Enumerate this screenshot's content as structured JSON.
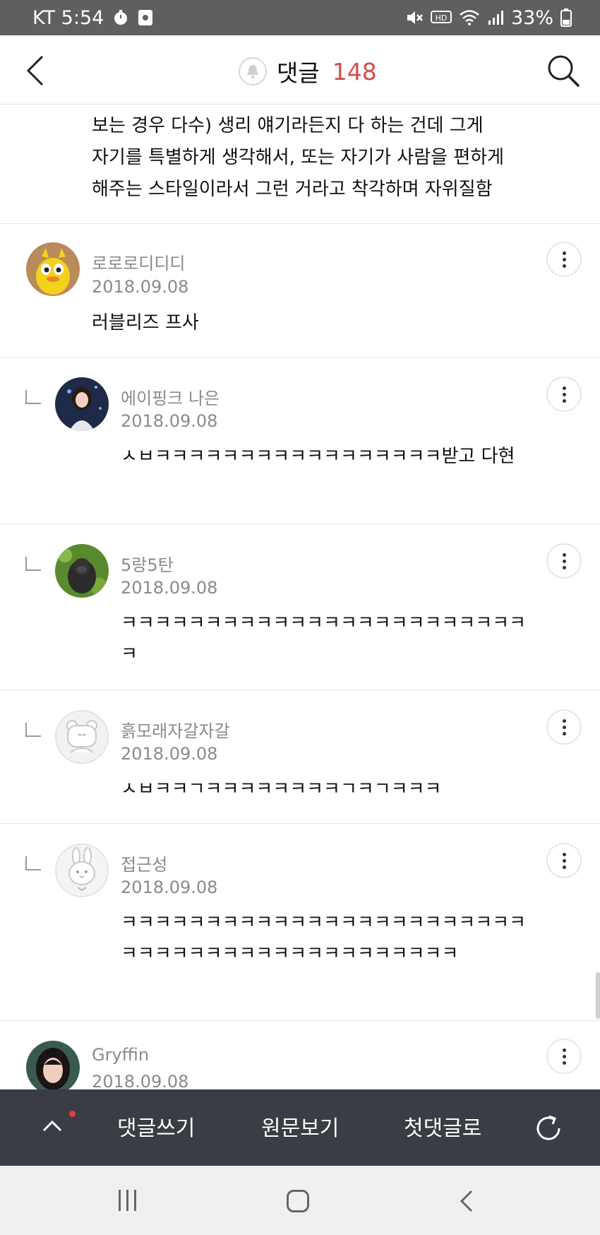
{
  "status_bar": {
    "carrier_time": "KT 5:54",
    "battery": "33%",
    "icons": [
      "timer-icon",
      "screen-record-icon",
      "mute-icon",
      "hd-icon",
      "wifi-icon",
      "signal-icon",
      "battery-icon"
    ]
  },
  "header": {
    "title": "댓글",
    "count": "148",
    "icons": [
      "back-arrow-icon",
      "bell-icon",
      "search-icon"
    ]
  },
  "previous_comment_tail": {
    "lines": [
      "보는 경우 다수) 생리 얘기라든지 다 하는 건데 그게",
      "자기를 특별하게 생각해서, 또는 자기가 사람을 편하게",
      "해주는 스타일이라서 그런 거라고 착각하며 자위질함"
    ]
  },
  "comments": [
    {
      "name": "로로로디디디",
      "date": "2018.09.08",
      "body": "러블리즈 프사",
      "reply": false,
      "avatar": "yellow-character"
    },
    {
      "name": "에이핑크 나은",
      "date": "2018.09.08",
      "body": "ㅅㅂㅋㅋㅋㅋㅋㅋㅋㅋㅋㅋㅋㅋㅋㅋㅋㅋㅋ받고 다현",
      "reply": true,
      "avatar": "person-photo"
    },
    {
      "name": "5랑5탄",
      "date": "2018.09.08",
      "body": "ㅋㅋㅋㅋㅋㅋㅋㅋㅋㅋㅋㅋㅋㅋㅋㅋㅋㅋㅋㅋㅋㅋㅋㅋㅋ",
      "reply": true,
      "avatar": "gorilla-photo"
    },
    {
      "name": "흙모래자갈자갈",
      "date": "2018.09.08",
      "body": "ㅅㅂㅋㅋㄱㅋㅋㅋㅋㅋㅋㅋㅋㄱㅋㄱㅋㅋㅋ",
      "reply": true,
      "avatar": "default-bear"
    },
    {
      "name": "접근성",
      "date": "2018.09.08",
      "body": "ㅋㅋㅋㅋㅋㅋㅋㅋㅋㅋㅋㅋㅋㅋㅋㅋㅋㅋㅋㅋㅋㅋㅋㅋㅋㅋㅋㅋㅋㅋㅋㅋㅋㅋㅋㅋㅋㅋㅋㅋㅋㅋㅋㅋ",
      "reply": true,
      "avatar": "default-rabbit"
    },
    {
      "name": "Gryffin",
      "date": "2018.09.08",
      "body": "",
      "reply": false,
      "avatar": "person-photo-2"
    }
  ],
  "bottom_bar": {
    "write_label": "댓글쓰기",
    "original_label": "원문보기",
    "first_label": "첫댓글로"
  },
  "colors": {
    "accent_count": "#d54c4c",
    "bottom_bar_bg": "#3b3d44",
    "status_bar_bg": "#5f5f5f",
    "notification_dot": "#e53d3d"
  }
}
